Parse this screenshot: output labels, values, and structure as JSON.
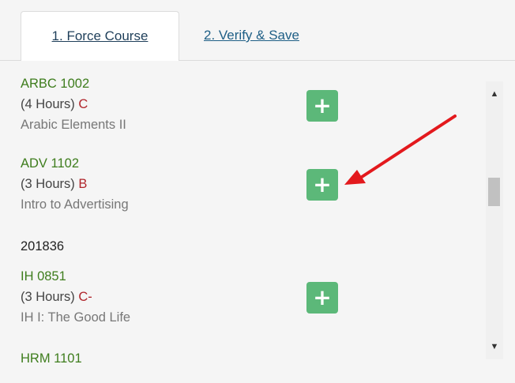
{
  "tabs": [
    {
      "label": "1. Force Course",
      "active": true
    },
    {
      "label": "2. Verify & Save",
      "active": false
    }
  ],
  "courses": [
    {
      "code": "ARBC 1002",
      "hours": "(4 Hours)",
      "grade": "C",
      "title": "Arabic Elements II",
      "action": "plus-icon"
    },
    {
      "code": "ADV 1102",
      "hours": "(3 Hours)",
      "grade": "B",
      "title": "Intro to Advertising",
      "action": "plus-icon"
    },
    {
      "code": "IH 0851",
      "hours": "(3 Hours)",
      "grade": "C-",
      "title": "IH I: The Good Life",
      "action": "plus-icon"
    },
    {
      "code": "HRM 1101"
    }
  ],
  "term": "201836",
  "annotation": {
    "type": "red-arrow",
    "color": "#e3191d"
  },
  "colors": {
    "course_code": "#3e7d1d",
    "grade": "#b0252b",
    "title": "#777777",
    "add_button": "#5cb879",
    "tab_link": "#1f5f86"
  }
}
